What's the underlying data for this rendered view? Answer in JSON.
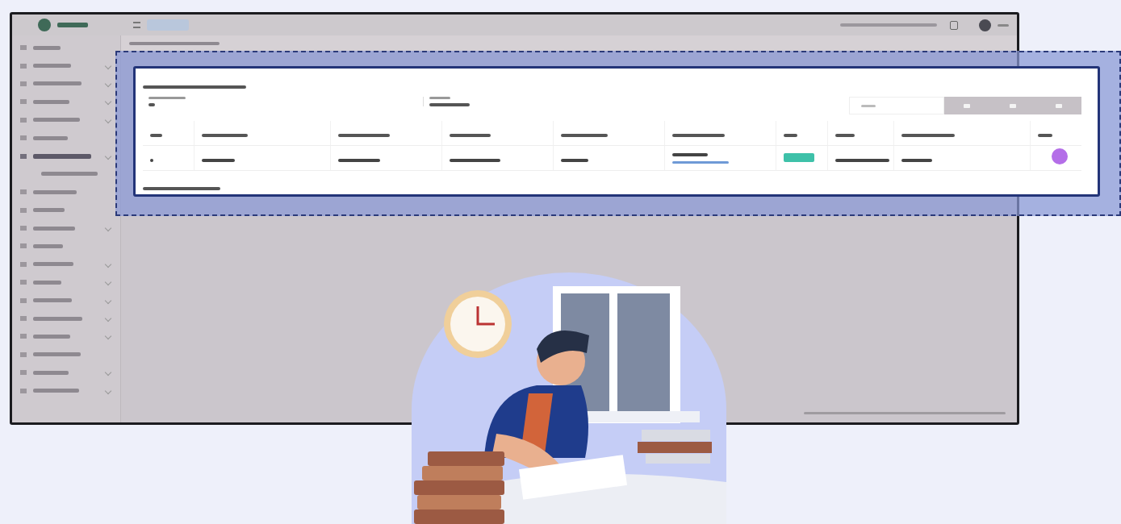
{
  "app_window": {
    "sidebar": {
      "items": [
        {
          "kind": "plain",
          "highlighted": false
        },
        {
          "kind": "chevron",
          "highlighted": false
        },
        {
          "kind": "chevron",
          "highlighted": false
        },
        {
          "kind": "chevron",
          "highlighted": false
        },
        {
          "kind": "chevron",
          "highlighted": false
        },
        {
          "kind": "plain",
          "highlighted": false
        },
        {
          "kind": "chevron",
          "highlighted": true
        },
        {
          "kind": "sub",
          "highlighted": false
        },
        {
          "kind": "plain",
          "highlighted": false
        },
        {
          "kind": "plain",
          "highlighted": false
        },
        {
          "kind": "chevron",
          "highlighted": false
        },
        {
          "kind": "plain",
          "highlighted": false
        },
        {
          "kind": "chevron",
          "highlighted": false
        },
        {
          "kind": "chevron",
          "highlighted": false
        },
        {
          "kind": "chevron",
          "highlighted": false
        },
        {
          "kind": "chevron",
          "highlighted": false
        },
        {
          "kind": "chevron",
          "highlighted": false
        },
        {
          "kind": "plain",
          "highlighted": false
        },
        {
          "kind": "chevron",
          "highlighted": false
        },
        {
          "kind": "chevron",
          "highlighted": false
        }
      ]
    }
  },
  "highlight_card": {
    "table": {
      "columns": [
        {
          "kind": "narrow"
        },
        {
          "kind": "wide"
        },
        {
          "kind": "wide"
        },
        {
          "kind": "wide"
        },
        {
          "kind": "wide"
        },
        {
          "kind": "wide"
        },
        {
          "kind": "narrow"
        },
        {
          "kind": "narrow"
        },
        {
          "kind": "wide"
        },
        {
          "kind": "narrow"
        }
      ],
      "rows": [
        {
          "cells": [
            {
              "kind": "text"
            },
            {
              "kind": "text"
            },
            {
              "kind": "text"
            },
            {
              "kind": "text"
            },
            {
              "kind": "text"
            },
            {
              "kind": "link"
            },
            {
              "kind": "badge",
              "color": "#3ec1a9"
            },
            {
              "kind": "text"
            },
            {
              "kind": "text"
            },
            {
              "kind": "action",
              "color": "#b46ee8"
            }
          ]
        }
      ]
    }
  },
  "illustration": {
    "kind": "student-studying"
  }
}
